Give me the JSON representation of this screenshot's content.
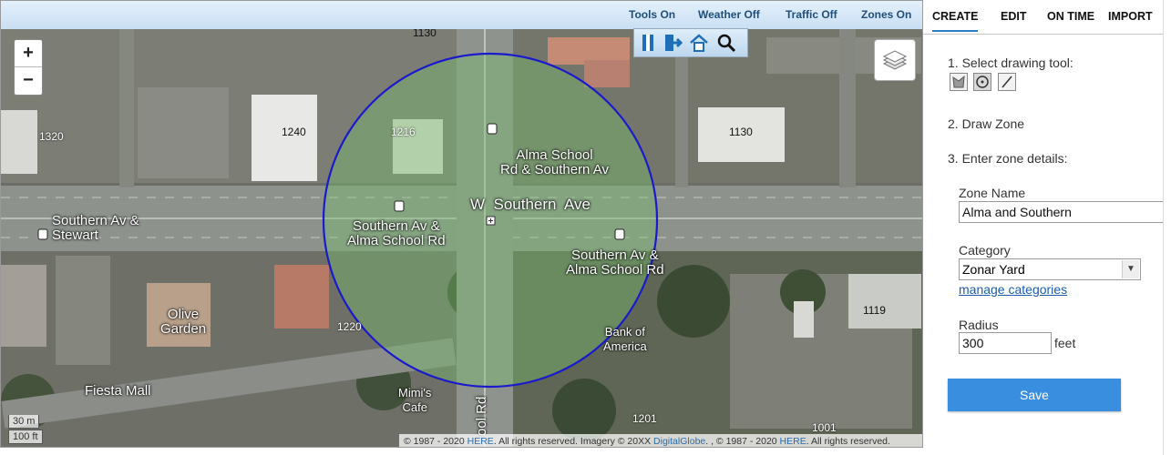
{
  "toolbar": {
    "tools_label": "Tools On",
    "weather_label": "Weather Off",
    "traffic_label": "Traffic Off",
    "zones_label": "Zones On"
  },
  "zoom": {
    "in_label": "+",
    "out_label": "−"
  },
  "map": {
    "labels": {
      "southern_stewart": "Southern Av &\nStewart",
      "w_southern": "W  Southern  Ave",
      "alma_stop_north": "Alma School\nRd & Southern Av",
      "southern_alma_west": "Southern Av &\nAlma School Rd",
      "southern_alma_east": "Southern Av &\nAlma School Rd",
      "olive_garden": "Olive\nGarden",
      "bank_of_america": "Bank of\nAmerica",
      "fiesta_mall": "Fiesta  Mall",
      "mimis_cafe": "Mimi's\nCafe",
      "alma_school_rd": "ool Rd"
    },
    "buildings": {
      "b1130a": "1130",
      "b1320": "1320",
      "b1240": "1240",
      "b1216": "1216",
      "b1130b": "1130",
      "b1220": "1220",
      "b1119": "1119",
      "b1201": "1201",
      "b1001": "1001"
    },
    "scale_m": "30 m",
    "scale_ft": "100 ft",
    "zone_color": "#1a1acc",
    "copyright": {
      "part1": "© 1987 - 2020 ",
      "here1": "HERE",
      "part2": ". All rights reserved. Imagery © 20XX ",
      "digitalglobe": "DigitalGlobe",
      "part3": ". , © 1987 - 2020 ",
      "here2": "HERE",
      "part4": ". All rights reserved."
    }
  },
  "tabs": {
    "create": "CREATE",
    "edit": "EDIT",
    "on_time": "ON TIME",
    "import": "IMPORT"
  },
  "form": {
    "step1": "1. Select drawing tool:",
    "step2": "2. Draw Zone",
    "step3": "3. Enter zone details:",
    "zone_name_label": "Zone Name",
    "zone_name_value": "Alma and Southern",
    "category_label": "Category",
    "category_value": "Zonar Yard",
    "manage_categories": "manage categories",
    "radius_label": "Radius",
    "radius_value": "300",
    "radius_unit": "feet",
    "save_label": "Save"
  },
  "colors": {
    "accent": "#3a8ee0",
    "link": "#1a5fb4"
  }
}
